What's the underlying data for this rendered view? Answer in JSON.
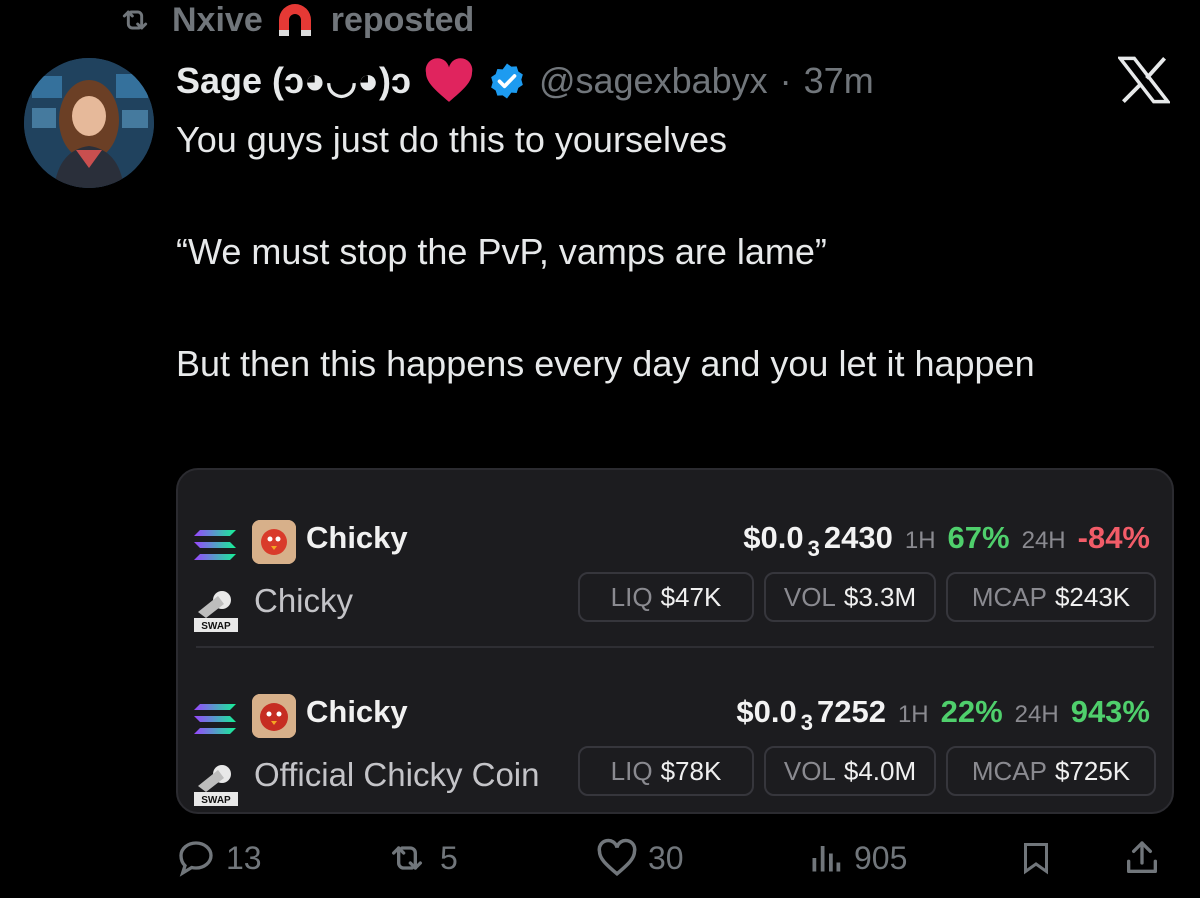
{
  "repost": {
    "user": "Nxive",
    "label": "reposted",
    "icon": "retweet-icon",
    "badge_icon": "magnet-icon"
  },
  "tweet": {
    "display_name": "Sage (ↄ◕◡◕)ↄ",
    "handle": "@sagexbabyx",
    "separator": "·",
    "time": "37m",
    "text_lines": [
      "You guys just do this to yourselves",
      "“We must stop the PvP, vamps are lame”",
      "But then this happens every day and you let it happen"
    ],
    "colors": {
      "verified": "#1d9bf0",
      "heart": "#e0245e"
    }
  },
  "card": {
    "tokens": [
      {
        "symbol": "Chicky",
        "name": "Chicky",
        "price_prefix": "$0.0",
        "price_zero_count": "3",
        "price_digits": "2430",
        "h1_label": "1H",
        "h1_change": "67%",
        "h24_label": "24H",
        "h24_change": "-84%",
        "liq_label": "LIQ",
        "liq": "$47K",
        "vol_label": "VOL",
        "vol": "$3.3M",
        "mcap_label": "MCAP",
        "mcap": "$243K",
        "swap_label": "SWAP"
      },
      {
        "symbol": "Chicky",
        "name": "Official Chicky Coin",
        "price_prefix": "$0.0",
        "price_zero_count": "3",
        "price_digits": "7252",
        "h1_label": "1H",
        "h1_change": "22%",
        "h24_label": "24H",
        "h24_change": "943%",
        "liq_label": "LIQ",
        "liq": "$78K",
        "vol_label": "VOL",
        "vol": "$4.0M",
        "mcap_label": "MCAP",
        "mcap": "$725K",
        "swap_label": "SWAP"
      }
    ],
    "colors": {
      "positive": "#4fcf6c",
      "negative": "#f25c68"
    }
  },
  "actions": {
    "replies": "13",
    "reposts": "5",
    "likes": "30",
    "views": "905"
  }
}
